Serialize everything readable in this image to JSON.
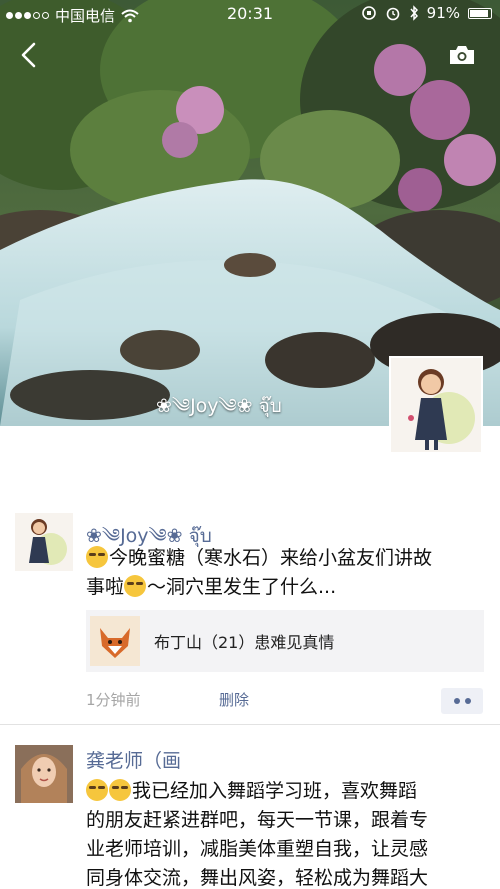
{
  "status_bar": {
    "carrier": "中国电信",
    "time": "20:31",
    "battery": "91%"
  },
  "icons": {
    "back": "back-arrow-icon",
    "camera": "camera-icon",
    "wifi": "wifi-icon",
    "alarm": "alarm-icon",
    "bluetooth": "bluetooth-icon",
    "battery": "battery-icon"
  },
  "profile": {
    "name": "❀༄Joy༄❀ จุ๊บ"
  },
  "posts": [
    {
      "name": "❀༄Joy༄❀ จุ๊บ",
      "text_line1": "今晚蜜糖（寒水石）来给小盆友们讲故",
      "text_line2_a": "事啦",
      "text_line2_b": "～洞穴里发生了什么...",
      "link_title": "布丁山（21）患难见真情",
      "time": "1分钟前",
      "delete_label": "删除"
    },
    {
      "name": "龚老师（画",
      "lines": [
        "我已经加入舞蹈学习班，喜欢舞蹈",
        "的朋友赶紧进群吧，每天一节课，跟着专",
        "业老师培训，减脂美体重塑自我，让灵感",
        "同身体交流，舞出风姿，轻松成为舞蹈大"
      ]
    }
  ]
}
